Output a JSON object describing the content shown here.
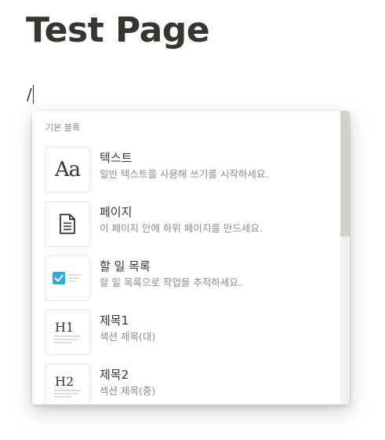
{
  "page": {
    "title": "Test Page",
    "editor_text": "/"
  },
  "menu": {
    "section_header": "기본 블록",
    "items": [
      {
        "icon": "text-aa-icon",
        "icon_text": "Aa",
        "title": "텍스트",
        "description": "일반 텍스트를 사용해 쓰기를 시작하세요.",
        "selected": true
      },
      {
        "icon": "page-document-icon",
        "title": "페이지",
        "description": "이 페이지 안에 하위 페이지를 만드세요."
      },
      {
        "icon": "todo-checkbox-icon",
        "title": "할 일 목록",
        "description": "할 일 목록으로 작업을 추적하세요."
      },
      {
        "icon": "heading-1-icon",
        "icon_text": "H1",
        "title": "제목1",
        "description": "섹션 제목(대)"
      },
      {
        "icon": "heading-2-icon",
        "icon_text": "H2",
        "title": "제목2",
        "description": "섹션 제목(중)"
      }
    ]
  },
  "colors": {
    "text": "#37352f",
    "muted": "#8c8b87",
    "checkbox_blue": "#2eaadc"
  }
}
